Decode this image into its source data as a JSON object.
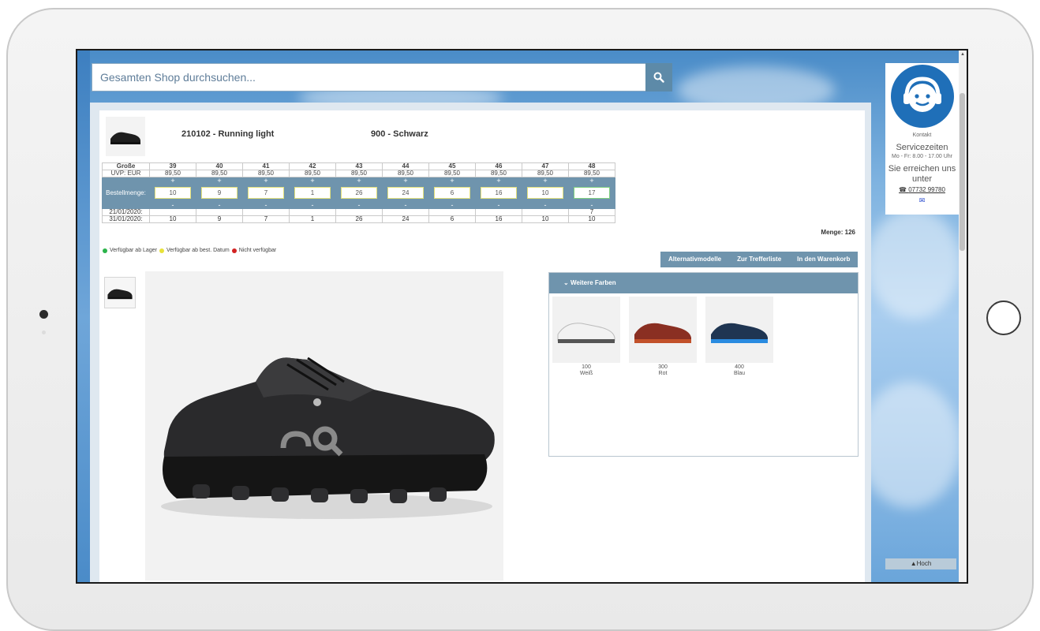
{
  "search": {
    "placeholder": "Gesamten Shop durchsuchen..."
  },
  "product": {
    "article": "210102 - Running light",
    "color": "900 - Schwarz"
  },
  "size_table": {
    "label_size": "Große",
    "label_uvp": "UVP: EUR",
    "label_qty": "Bestellmenge:",
    "plus": "+",
    "minus": "-",
    "date1": "21/01/2020:",
    "date2": "31/01/2020:",
    "columns": [
      {
        "size": "39",
        "uvp": "89,50",
        "qty": "10",
        "d1": "",
        "d2": "10"
      },
      {
        "size": "40",
        "uvp": "89,50",
        "qty": "9",
        "d1": "",
        "d2": "9"
      },
      {
        "size": "41",
        "uvp": "89,50",
        "qty": "7",
        "d1": "",
        "d2": "7"
      },
      {
        "size": "42",
        "uvp": "89,50",
        "qty": "1",
        "d1": "",
        "d2": "1"
      },
      {
        "size": "43",
        "uvp": "89,50",
        "qty": "26",
        "d1": "",
        "d2": "26"
      },
      {
        "size": "44",
        "uvp": "89,50",
        "qty": "24",
        "d1": "",
        "d2": "24"
      },
      {
        "size": "45",
        "uvp": "89,50",
        "qty": "6",
        "d1": "",
        "d2": "6"
      },
      {
        "size": "46",
        "uvp": "89,50",
        "qty": "16",
        "d1": "",
        "d2": "16"
      },
      {
        "size": "47",
        "uvp": "89,50",
        "qty": "10",
        "d1": "",
        "d2": "10"
      },
      {
        "size": "48",
        "uvp": "89,50",
        "qty": "17",
        "d1": "7",
        "d2": "10"
      }
    ]
  },
  "menge": "Menge: 126",
  "legend": {
    "in_stock": "Verfügbar ab Lager",
    "from_date": "Verfügbar ab best. Datum",
    "not_available": "Nicht verfügbar",
    "colors": {
      "green": "#2bb34a",
      "yellow": "#e8e23a",
      "red": "#d22222"
    }
  },
  "actions": {
    "alternatives": "Alternativmodelle",
    "results": "Zur Trefferliste",
    "cart": "In den Warenkorb"
  },
  "more_colors": {
    "title": "Weitere Farben",
    "items": [
      {
        "code": "100",
        "name": "Weiß"
      },
      {
        "code": "300",
        "name": "Rot"
      },
      {
        "code": "400",
        "name": "Blau"
      }
    ]
  },
  "side": {
    "kontakt": "Kontakt",
    "service": "Servicezeiten",
    "hours": "Mo - Fr: 8.00 - 17.00 Uhr",
    "reach": "Sie erreichen uns unter",
    "phone": "07732 99780",
    "back_to_top": "Hoch"
  },
  "theme": {
    "accent": "#6f94ad",
    "avatar": "#1f6fb8"
  }
}
